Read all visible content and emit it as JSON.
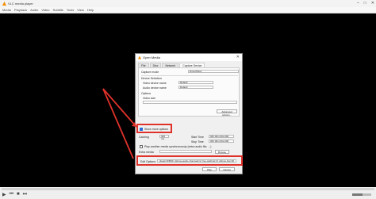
{
  "app": {
    "title": "VLC media player"
  },
  "menu": [
    "Media",
    "Playback",
    "Audio",
    "Video",
    "Subtitle",
    "Tools",
    "View",
    "Help"
  ],
  "player": {
    "time_left": "--:--",
    "time_right": "--:--"
  },
  "dialog": {
    "title": "Open Media",
    "tabs": [
      "File",
      "Disc",
      "Network",
      "Capture Device"
    ],
    "capture_mode_label": "Capture mode",
    "capture_mode_value": "DirectShow",
    "device_selection_label": "Device Selection",
    "video_device_label": "Video device name",
    "video_device_value": "Default",
    "audio_device_label": "Audio device name",
    "audio_device_value": "Default",
    "options_label": "Options",
    "video_size_label": "Video size",
    "advanced_button": "Advanced options...",
    "show_more_label": "Show more options",
    "caching_label": "Caching",
    "caching_value": "300 ms",
    "start_time_label": "Start Time",
    "start_time_value": "00h:00m:00s.000",
    "stop_time_label": "Stop Time",
    "stop_time_value": "00h:00m:00s.000",
    "sync_label": "Play another media synchronously (extra audio file, ...)",
    "extra_media_label": "Extra media",
    "browse_button": "Browse",
    "edit_options_label": "Edit Options",
    "edit_options_value": ":dsoat=WM99 :dshow-audio-channels=2 :live-caching=0 :dshow-fps=30",
    "play_button": "Play",
    "cancel_button": "Cancel"
  },
  "colors": {
    "accent": "#e0322b",
    "vlc_orange": "#f28c00"
  }
}
